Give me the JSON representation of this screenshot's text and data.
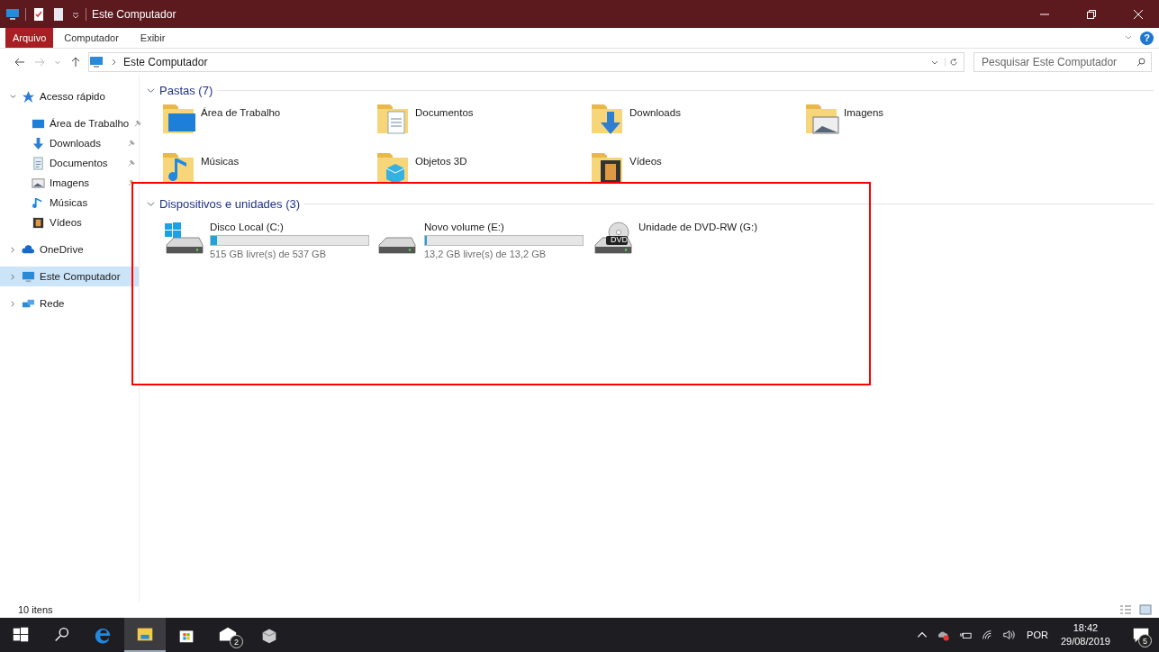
{
  "window": {
    "title": "Este Computador"
  },
  "ribbon_tabs": [
    {
      "label": "Arquivo",
      "selected": true
    },
    {
      "label": "Computador",
      "selected": false
    },
    {
      "label": "Exibir",
      "selected": false
    }
  ],
  "help_button": "?",
  "address": {
    "path": "Este Computador"
  },
  "search": {
    "placeholder": "Pesquisar Este Computador"
  },
  "sidebar": {
    "items": [
      {
        "label": "Acesso rápido",
        "kind": "star",
        "expanded": true,
        "selected": false,
        "children": [
          {
            "label": "Área de Trabalho",
            "kind": "desktop",
            "pinned": true
          },
          {
            "label": "Downloads",
            "kind": "download",
            "pinned": true
          },
          {
            "label": "Documentos",
            "kind": "document",
            "pinned": true
          },
          {
            "label": "Imagens",
            "kind": "picture",
            "pinned": true
          },
          {
            "label": "Músicas",
            "kind": "music",
            "pinned": false
          },
          {
            "label": "Vídeos",
            "kind": "video",
            "pinned": false
          }
        ]
      },
      {
        "label": "OneDrive",
        "kind": "cloud",
        "expanded": false,
        "selected": false
      },
      {
        "label": "Este Computador",
        "kind": "computer",
        "expanded": false,
        "selected": true
      },
      {
        "label": "Rede",
        "kind": "network",
        "expanded": false,
        "selected": false
      }
    ]
  },
  "groups": [
    {
      "title": "Pastas (7)",
      "kind": "folders",
      "items": [
        {
          "name": "Área de Trabalho",
          "kind": "desktop"
        },
        {
          "name": "Documentos",
          "kind": "document"
        },
        {
          "name": "Downloads",
          "kind": "download"
        },
        {
          "name": "Imagens",
          "kind": "picture"
        },
        {
          "name": "Músicas",
          "kind": "music"
        },
        {
          "name": "Objetos 3D",
          "kind": "cube"
        },
        {
          "name": "Vídeos",
          "kind": "video"
        }
      ]
    },
    {
      "title": "Dispositivos e unidades (3)",
      "kind": "drives",
      "highlighted": true,
      "items": [
        {
          "name": "Disco Local (C:)",
          "kind": "system",
          "level": 0.04,
          "free": "515 GB livre(s) de 537 GB"
        },
        {
          "name": "Novo volume (E:)",
          "kind": "disk",
          "level": 0.01,
          "free": "13,2 GB livre(s) de 13,2 GB"
        },
        {
          "name": "Unidade de DVD-RW (G:)",
          "kind": "dvd",
          "label": "DVD"
        }
      ]
    }
  ],
  "status_bar": {
    "count": "10 itens"
  },
  "taskbar": {
    "apps": [
      {
        "kind": "start",
        "active": false
      },
      {
        "kind": "search",
        "active": false
      },
      {
        "kind": "edge",
        "active": false
      },
      {
        "kind": "explorer",
        "active": true
      },
      {
        "kind": "store",
        "active": false
      },
      {
        "kind": "mail",
        "active": false,
        "badge": "2"
      },
      {
        "kind": "box",
        "active": false
      }
    ],
    "language": "POR",
    "time": "18:42",
    "date": "29/08/2019",
    "notifications": "5"
  }
}
